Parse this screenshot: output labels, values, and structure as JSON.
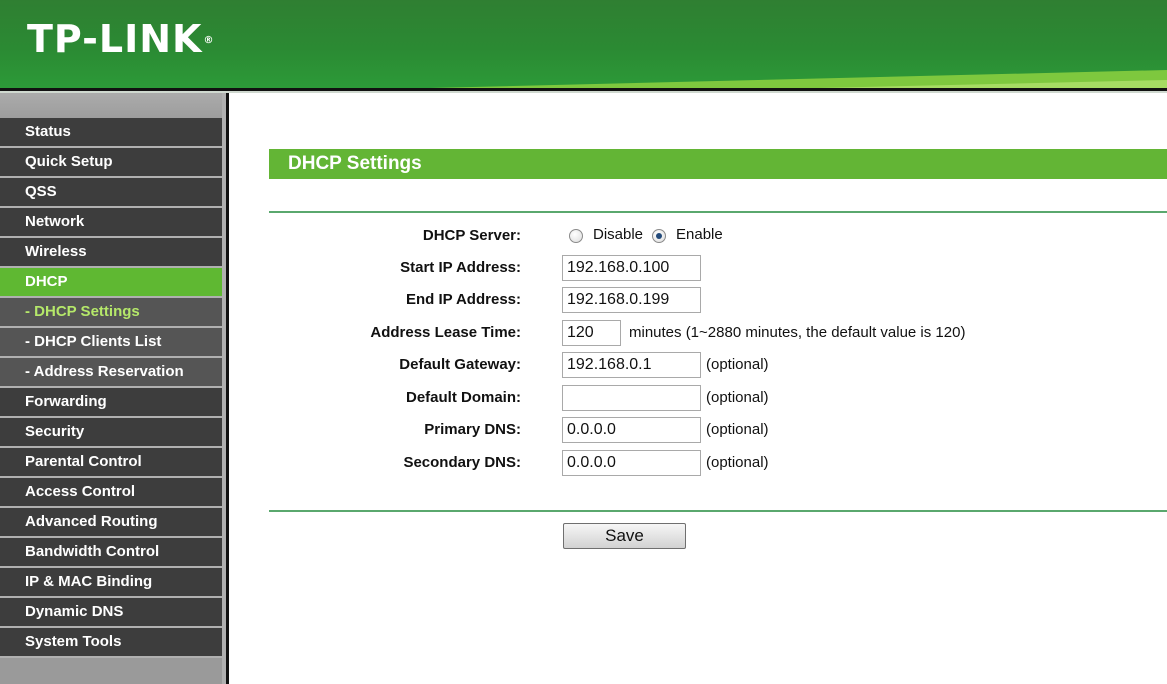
{
  "header": {
    "logo": "TP-LINK",
    "logo_mark": "®"
  },
  "sidebar": {
    "items": [
      {
        "label": "Status",
        "kind": "top"
      },
      {
        "label": "Quick Setup",
        "kind": "top"
      },
      {
        "label": "QSS",
        "kind": "top"
      },
      {
        "label": "Network",
        "kind": "top"
      },
      {
        "label": "Wireless",
        "kind": "top"
      },
      {
        "label": "DHCP",
        "kind": "active"
      },
      {
        "label": "- DHCP Settings",
        "kind": "sub-current"
      },
      {
        "label": "- DHCP Clients List",
        "kind": "sub"
      },
      {
        "label": "- Address Reservation",
        "kind": "sub"
      },
      {
        "label": "Forwarding",
        "kind": "top"
      },
      {
        "label": "Security",
        "kind": "top"
      },
      {
        "label": "Parental Control",
        "kind": "top"
      },
      {
        "label": "Access Control",
        "kind": "top"
      },
      {
        "label": "Advanced Routing",
        "kind": "top"
      },
      {
        "label": "Bandwidth Control",
        "kind": "top"
      },
      {
        "label": "IP & MAC Binding",
        "kind": "top"
      },
      {
        "label": "Dynamic DNS",
        "kind": "top"
      },
      {
        "label": "System Tools",
        "kind": "top"
      }
    ]
  },
  "main": {
    "title": "DHCP Settings",
    "dhcp_server": {
      "label": "DHCP Server:",
      "options": [
        "Disable",
        "Enable"
      ],
      "selected": "Enable"
    },
    "start_ip": {
      "label": "Start IP Address:",
      "value": "192.168.0.100"
    },
    "end_ip": {
      "label": "End IP Address:",
      "value": "192.168.0.199"
    },
    "lease_time": {
      "label": "Address Lease Time:",
      "value": "120",
      "hint": "minutes (1~2880 minutes, the default value is 120)"
    },
    "gateway": {
      "label": "Default Gateway:",
      "value": "192.168.0.1",
      "hint": "(optional)"
    },
    "domain": {
      "label": "Default Domain:",
      "value": "",
      "hint": "(optional)"
    },
    "primary_dns": {
      "label": "Primary DNS:",
      "value": "0.0.0.0",
      "hint": "(optional)"
    },
    "secondary_dns": {
      "label": "Secondary DNS:",
      "value": "0.0.0.0",
      "hint": "(optional)"
    },
    "save_label": "Save"
  },
  "colors": {
    "brand_green": "#2b8a33",
    "accent_green": "#63b535",
    "menu_dark": "#3d3d3d",
    "submenu_highlight": "#b5e86a"
  }
}
